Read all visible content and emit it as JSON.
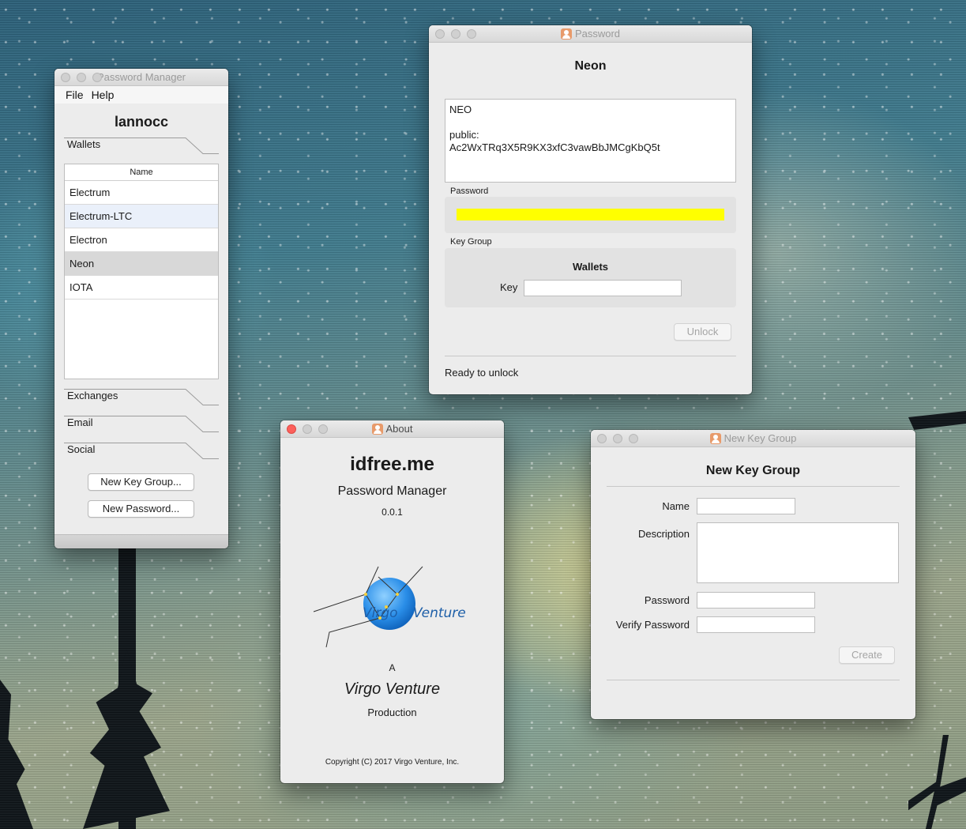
{
  "password_manager": {
    "title": "Password Manager",
    "menu": [
      "File",
      "Help"
    ],
    "user": "lannocc",
    "wallets_label": "Wallets",
    "table_header": "Name",
    "wallets": [
      "Electrum",
      "Electrum-LTC",
      "Electron",
      "Neon",
      "IOTA"
    ],
    "selected_wallet": "Neon",
    "sections": [
      "Exchanges",
      "Email",
      "Social"
    ],
    "new_key_group_button": "New Key Group...",
    "new_password_button": "New Password..."
  },
  "password_window": {
    "title": "Password",
    "heading": "Neon",
    "notes_line1": "NEO",
    "notes_line2": "public:",
    "notes_line3": "Ac2WxTRq3X5R9KX3xfC3vawBbJMCgKbQ5t",
    "password_label": "Password",
    "password_bar_color": "#ffff00",
    "key_group_label": "Key Group",
    "key_group_name": "Wallets",
    "key_label": "Key",
    "key_value": "",
    "unlock_button": "Unlock",
    "status": "Ready to unlock"
  },
  "about_window": {
    "title": "About",
    "app_name": "idfree.me",
    "product": "Password Manager",
    "version": "0.0.1",
    "logo_text_virgo": "Virgo",
    "logo_text_venture": "Venture",
    "a_label": "A",
    "company": "Virgo Venture",
    "production": "Production",
    "copyright": "Copyright (C) 2017 Virgo Venture, Inc."
  },
  "new_key_group_window": {
    "title": "New Key Group",
    "heading": "New Key Group",
    "name_label": "Name",
    "name_value": "",
    "description_label": "Description",
    "description_value": "",
    "password_label": "Password",
    "password_value": "",
    "verify_password_label": "Verify Password",
    "verify_password_value": "",
    "create_button": "Create"
  }
}
